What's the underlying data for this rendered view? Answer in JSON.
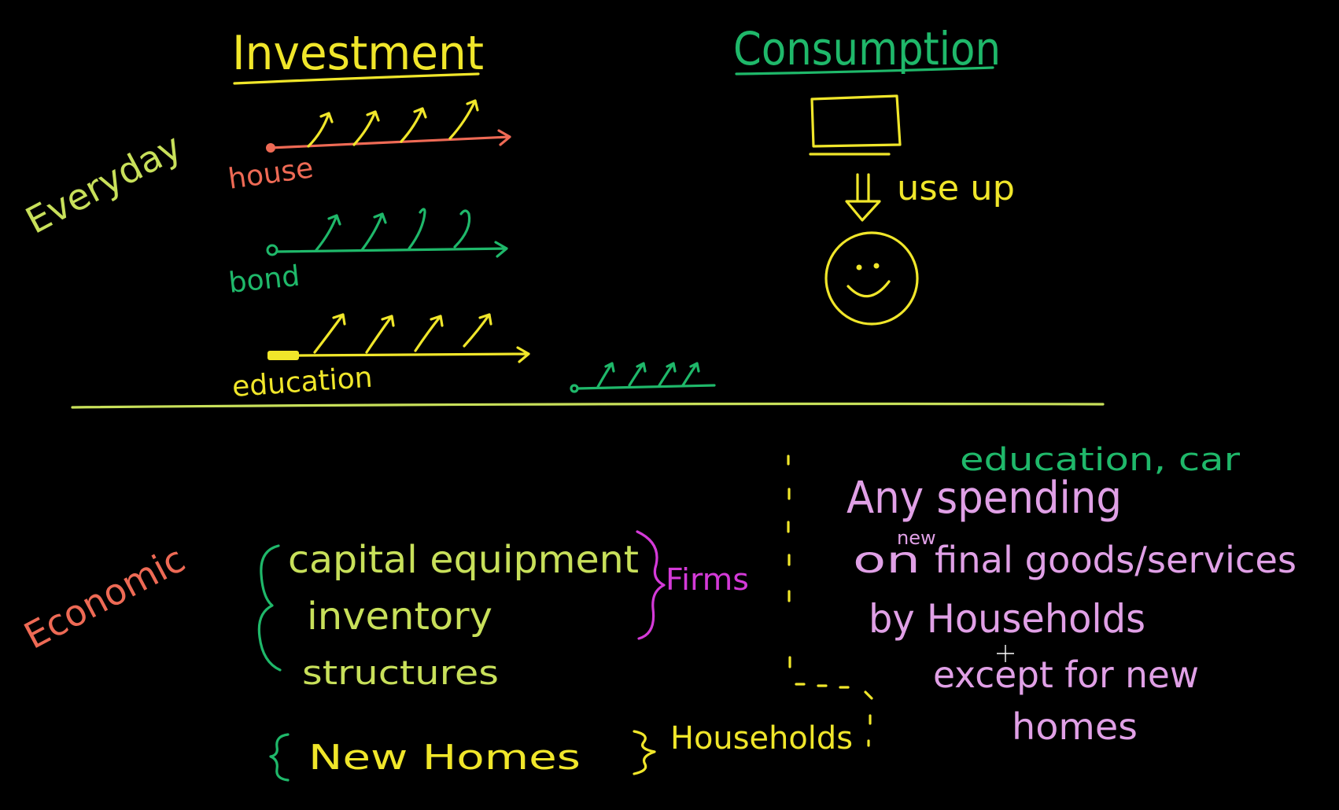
{
  "colors": {
    "background": "#000000",
    "yellow": "#f0e62a",
    "lime": "#c8e05a",
    "green": "#1fb86a",
    "salmon": "#ee6a55",
    "pink": "#e0a0e6",
    "magenta": "#d43ad8"
  },
  "headings": {
    "investment": "Investment",
    "consumption": "Consumption"
  },
  "row_labels": {
    "everyday": "Everyday",
    "economic": "Economic"
  },
  "investment_examples": [
    {
      "label": "house",
      "color": "salmon"
    },
    {
      "label": "bond",
      "color": "green"
    },
    {
      "label": "education",
      "color": "yellow"
    }
  ],
  "consumption_diagram": {
    "arrow_label": "use up",
    "icon_good": "box-icon",
    "icon_result": "smiley-face-icon"
  },
  "economic_investment": {
    "firm_items": [
      "capital equipment",
      "inventory",
      "structures"
    ],
    "firm_group_label": "Firms",
    "household_item": "New Homes",
    "household_group_label": "Households"
  },
  "economic_consumption": {
    "annotation": "education, car",
    "line1": "Any spending",
    "line2_prefix": "on",
    "line2_insert": "new",
    "line2_suffix": "final goods/services",
    "line3": "by Households",
    "line4": "except for new",
    "line5": "homes"
  },
  "cursor": {
    "icon": "crosshair-cursor-icon"
  }
}
